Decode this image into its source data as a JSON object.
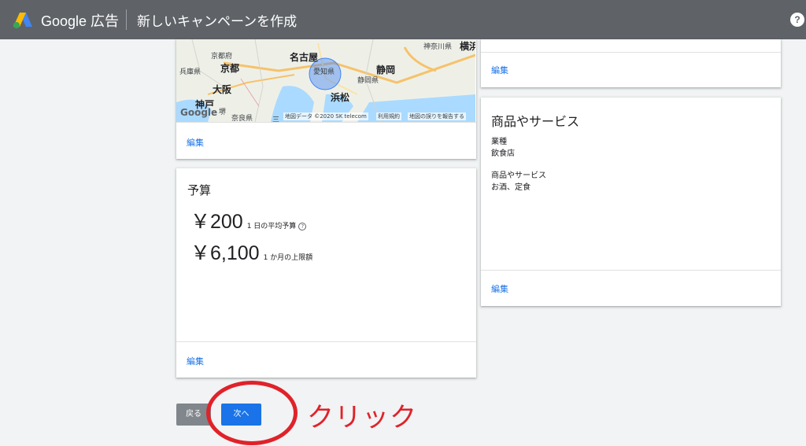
{
  "header": {
    "brand": "Google 広告",
    "title": "新しいキャンペーンを作成",
    "help_icon": "?"
  },
  "location_card": {
    "map": {
      "labels": [
        "兵庫県",
        "京都府",
        "京都",
        "大阪",
        "神戸",
        "堺",
        "奈良県",
        "三",
        "名古屋",
        "愛知県",
        "浜松",
        "静岡",
        "静岡県",
        "神奈川県",
        "横浜"
      ],
      "credit": {
        "data": "地図データ ©2020 SK telecom",
        "terms": "利用規約",
        "report": "地図の誤りを報告する"
      },
      "watermark": "Google"
    },
    "edit_label": "編集"
  },
  "budget_card": {
    "title": "予算",
    "daily": {
      "amount": "￥200",
      "note": "1 日の平均予算"
    },
    "monthly": {
      "amount": "￥6,100",
      "note": "1 か月の上限額"
    },
    "edit_label": "編集"
  },
  "right_top_card": {
    "edit_label": "編集"
  },
  "products_card": {
    "title": "商品やサービス",
    "industry_label": "業種",
    "industry_value": "飲食店",
    "products_label": "商品やサービス",
    "products_value": "お酒、定食",
    "edit_label": "編集"
  },
  "buttons": {
    "back": "戻る",
    "next": "次へ"
  },
  "annotation": {
    "text": "クリック",
    "color": "#e0222a"
  },
  "colors": {
    "header_bg": "#5f6368",
    "link": "#1a73e8",
    "primary_button": "#1a73e8"
  }
}
